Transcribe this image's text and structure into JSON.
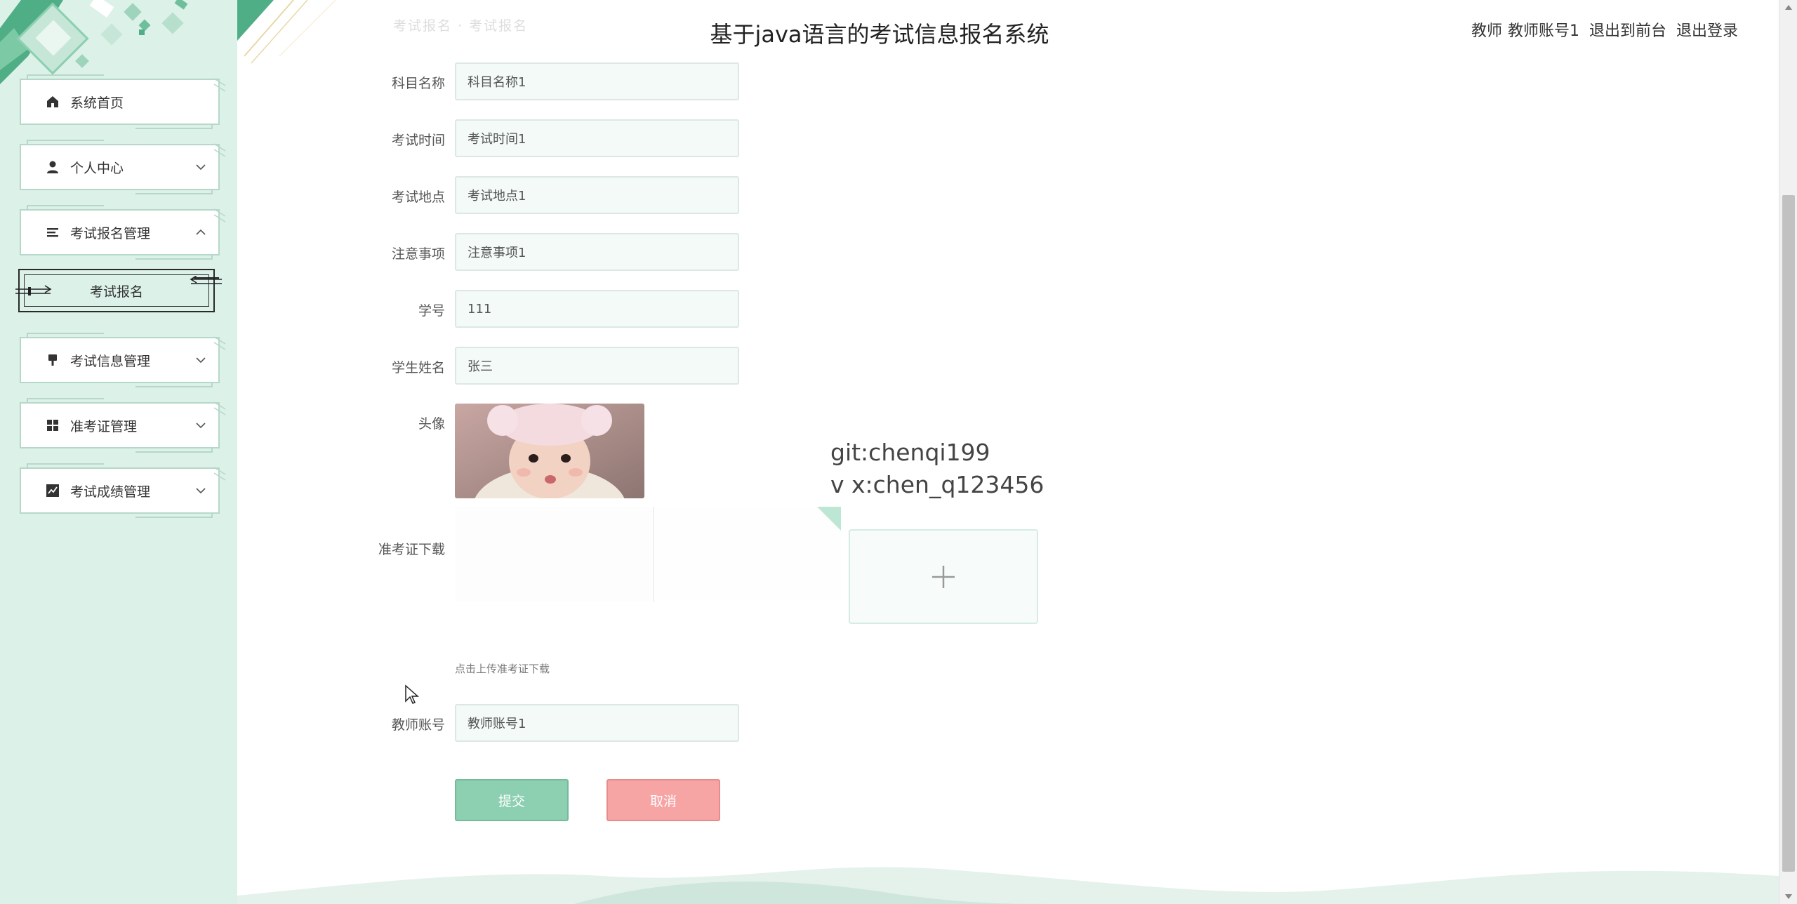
{
  "header": {
    "title": "基于java语言的考试信息报名系统",
    "role": "教师",
    "username": "教师账号1",
    "back_to_front": "退出到前台",
    "logout": "退出登录",
    "faded_text": "考试报名 · 考试报名"
  },
  "sidebar": {
    "items": [
      {
        "label": "系统首页",
        "icon": "home-icon"
      },
      {
        "label": "个人中心",
        "icon": "person-icon"
      },
      {
        "label": "考试报名管理",
        "icon": "list-icon"
      },
      {
        "label": "考试信息管理",
        "icon": "brush-icon"
      },
      {
        "label": "准考证管理",
        "icon": "grid-icon"
      },
      {
        "label": "考试成绩管理",
        "icon": "chart-icon"
      }
    ],
    "sub_item": {
      "label": "考试报名"
    }
  },
  "form": {
    "fields": [
      {
        "label": "科目名称",
        "value": "科目名称1"
      },
      {
        "label": "考试时间",
        "value": "考试时间1"
      },
      {
        "label": "考试地点",
        "value": "考试地点1"
      },
      {
        "label": "注意事项",
        "value": "注意事项1"
      },
      {
        "label": "学号",
        "value": "111"
      },
      {
        "label": "学生姓名",
        "value": "张三"
      }
    ],
    "avatar_label": "头像",
    "ticket_label": "准考证下载",
    "upload_tip": "点击上传准考证下载",
    "teacher_label": "教师账号",
    "teacher_value": "教师账号1",
    "submit": "提交",
    "cancel": "取消"
  },
  "watermark": {
    "line1": "git:chenqi199",
    "line2": "v x:chen_q123456"
  },
  "colors": {
    "sidebar_bg": "#dcf1e8",
    "accent": "#8ccfb1",
    "cancel": "#f7a4a4"
  }
}
